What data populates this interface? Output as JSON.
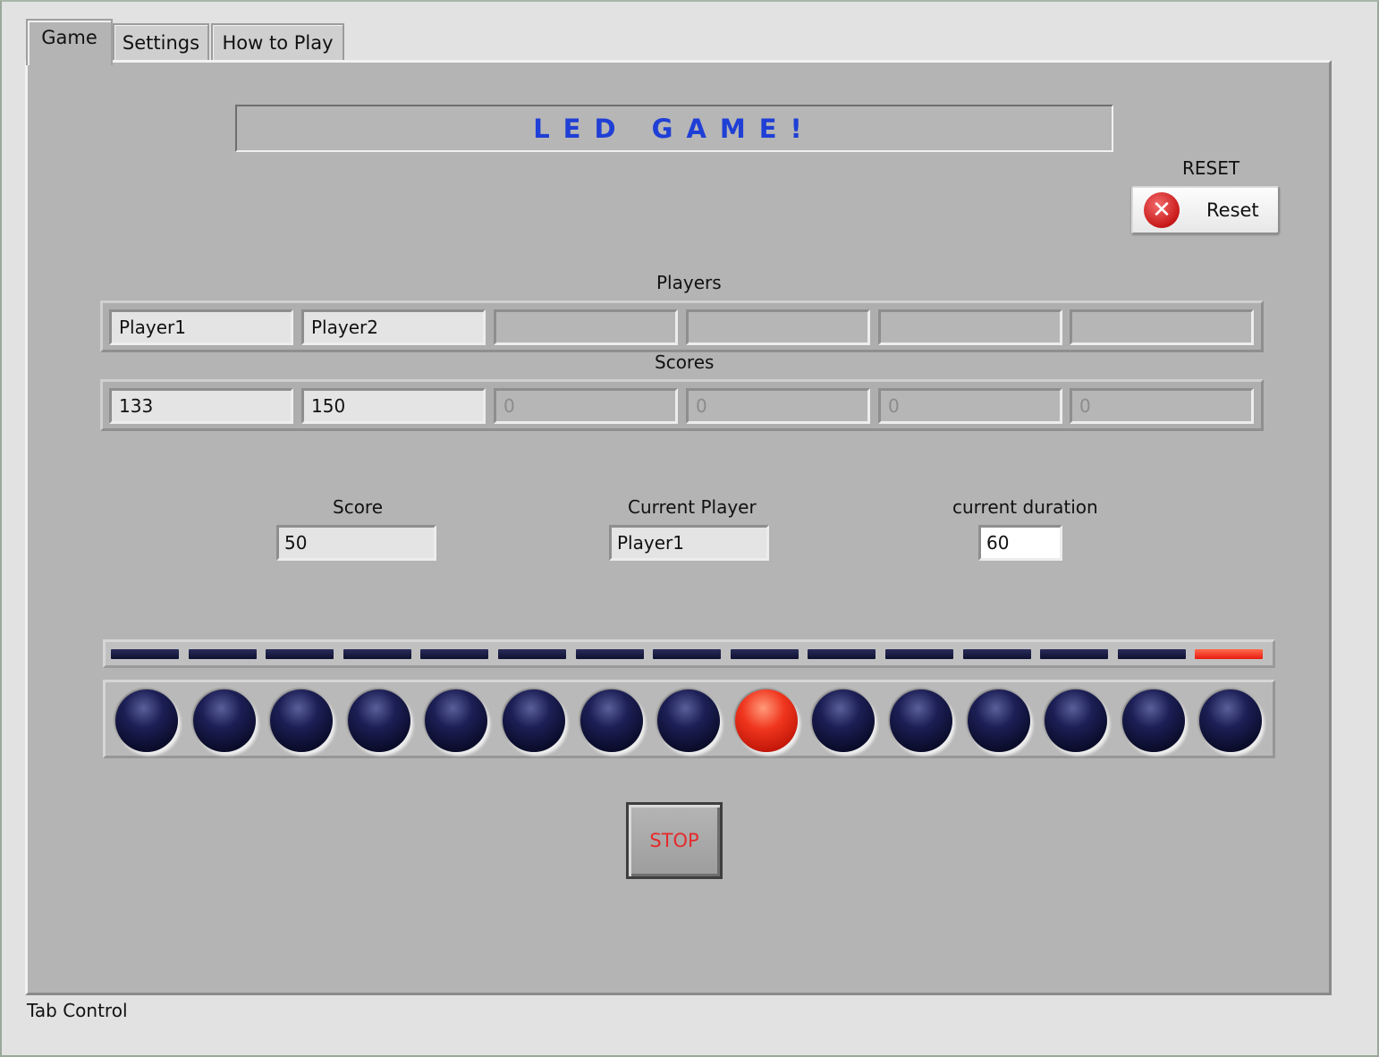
{
  "tabs": [
    {
      "label": "Game"
    },
    {
      "label": "Settings"
    },
    {
      "label": "How to Play"
    }
  ],
  "title": "LED GAME!",
  "reset": {
    "caption": "RESET",
    "button_label": "Reset"
  },
  "players": {
    "caption": "Players",
    "values": [
      "Player1",
      "Player2",
      "",
      "",
      "",
      ""
    ]
  },
  "scores": {
    "caption": "Scores",
    "values": [
      "133",
      "150",
      "0",
      "0",
      "0",
      "0"
    ]
  },
  "score": {
    "label": "Score",
    "value": "50"
  },
  "current_player": {
    "label": "Current Player",
    "value": "Player1"
  },
  "current_duration": {
    "label": "current duration",
    "value": "60"
  },
  "indicator_bar": {
    "count": 15,
    "lit_index": 14
  },
  "leds": {
    "count": 15,
    "lit_index": 8
  },
  "stop_button": {
    "label": "STOP"
  },
  "footer": {
    "label": "Tab Control"
  },
  "colors": {
    "title": "#1f3fd6",
    "led_on": "#e8321c",
    "led_off": "#111336",
    "stop_text": "#e52a2a"
  }
}
